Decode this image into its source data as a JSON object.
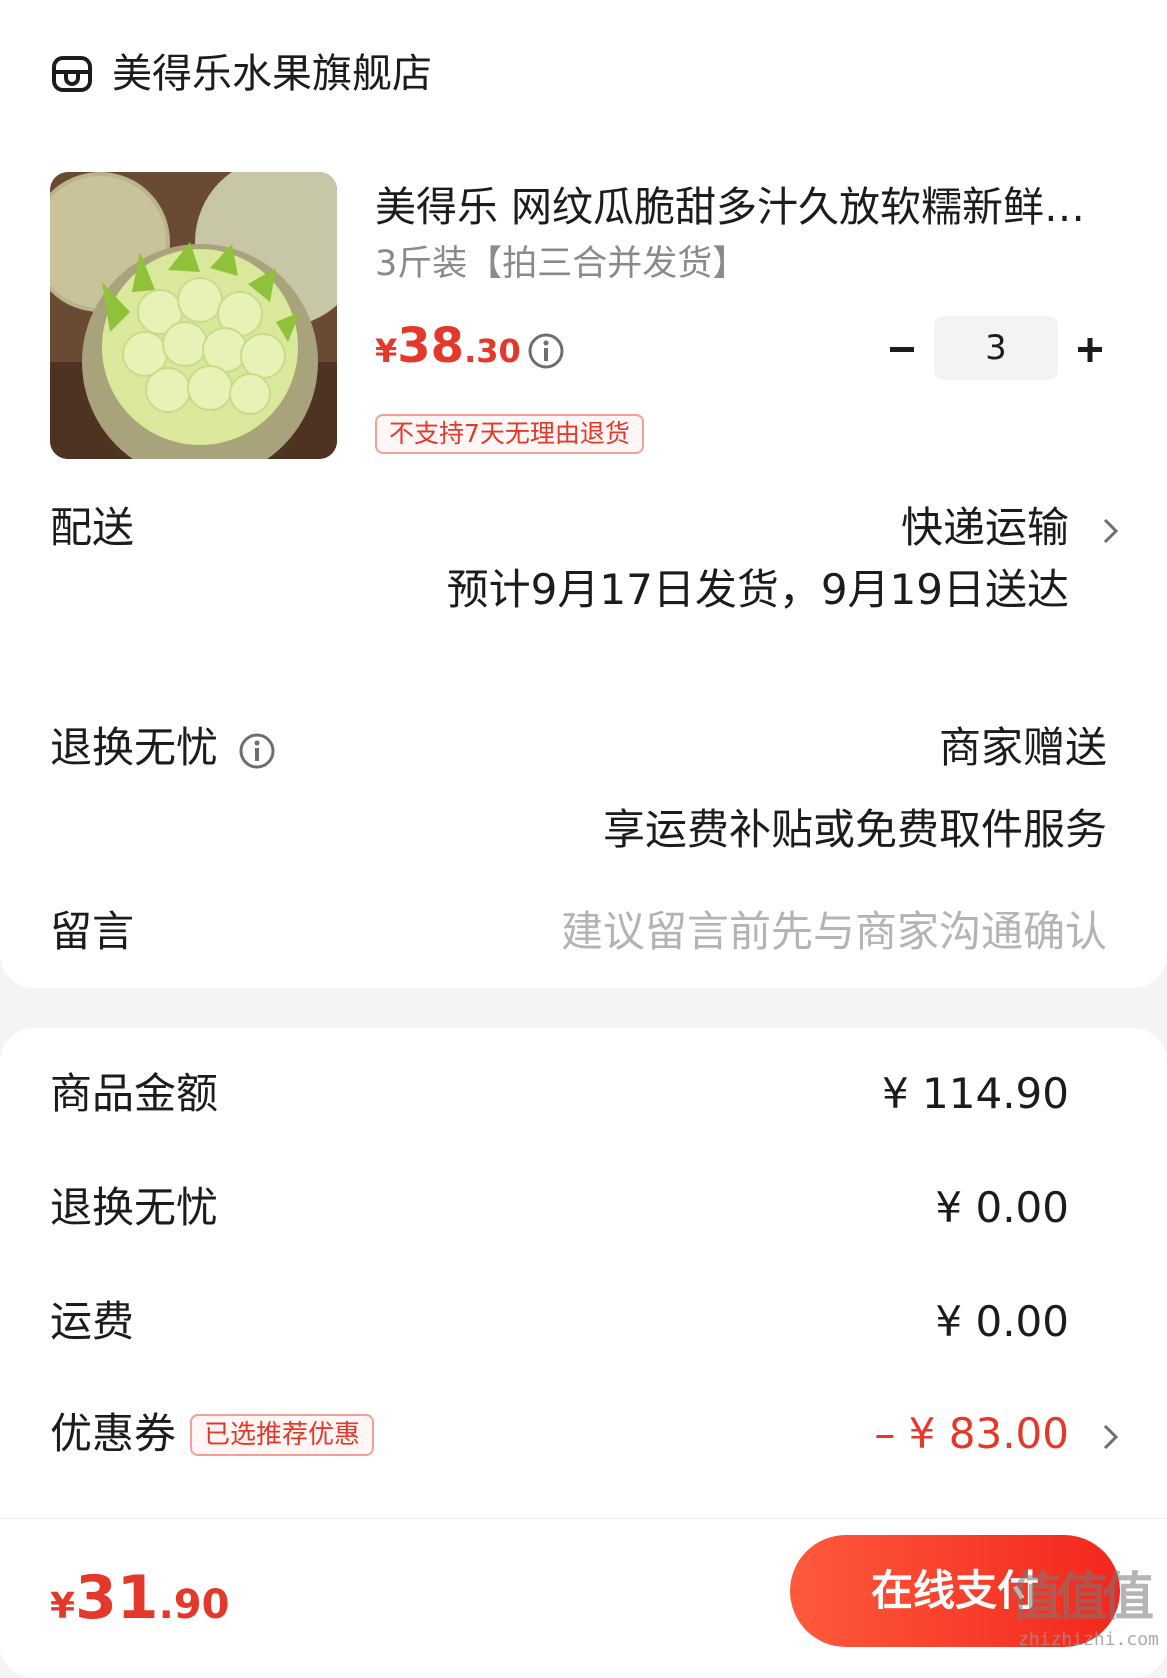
{
  "store": {
    "name": "美得乐水果旗舰店",
    "icon": "store-icon"
  },
  "product": {
    "title": "美得乐 网纹瓜脆甜多汁久放软糯新鲜…",
    "spec": "3斤装【拍三合并发货】",
    "price_symbol": "¥",
    "price_int": "38",
    "price_dec": ".30",
    "return_tag": "不支持7天无理由退货",
    "quantity": "3",
    "minus_label": "−",
    "plus_label": "+"
  },
  "delivery": {
    "label": "配送",
    "method": "快递运输",
    "estimate": "预计9月17日发货，9月19日送达"
  },
  "worry_free": {
    "label": "退换无忧",
    "value": "商家赠送",
    "description": "享运费补贴或免费取件服务"
  },
  "message": {
    "label": "留言",
    "placeholder": "建议留言前先与商家沟通确认"
  },
  "summary": {
    "subtotal_label": "商品金额",
    "subtotal_value": "¥ 114.90",
    "worry_fee_label": "退换无忧",
    "worry_fee_value": "¥ 0.00",
    "shipping_label": "运费",
    "shipping_value": "¥ 0.00",
    "coupon_label": "优惠券",
    "coupon_tag": "已选推荐优惠",
    "coupon_value": "– ¥ 83.00"
  },
  "footer": {
    "total_symbol": "¥",
    "total_int": "31",
    "total_dec": ".90",
    "pay_label": "在线支付"
  },
  "watermark": {
    "glyph": "值值值",
    "url": "zhizhizhi.com"
  },
  "colors": {
    "accent": "#e4392a",
    "muted": "#8a8a8e",
    "placeholder": "#b4b4b8"
  }
}
